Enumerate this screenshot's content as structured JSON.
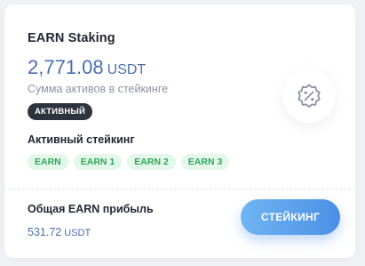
{
  "card": {
    "title": "EARN Staking",
    "amount": "2,771.08",
    "amount_currency": "USDT",
    "subtitle": "Сумма активов в стейкинге",
    "status": "АКТИВНЫЙ"
  },
  "active_staking": {
    "label": "Активный стейкинг",
    "tags": [
      "EARN",
      "EARN 1",
      "EARN 2",
      "EARN 3"
    ]
  },
  "profit": {
    "label": "Общая EARN прибыль",
    "value": "531.72",
    "currency": "USDT"
  },
  "button": {
    "label": "СТЕЙКИНГ"
  },
  "icons": {
    "percent": "percent-badge-icon"
  },
  "colors": {
    "accent_blue": "#4a6fae",
    "tag_green": "#2ea85b",
    "tag_green_bg": "#e3f7ea",
    "badge_dark": "#2f3340",
    "button_gradient_start": "#6fb5f2",
    "button_gradient_end": "#4b8fe6"
  }
}
